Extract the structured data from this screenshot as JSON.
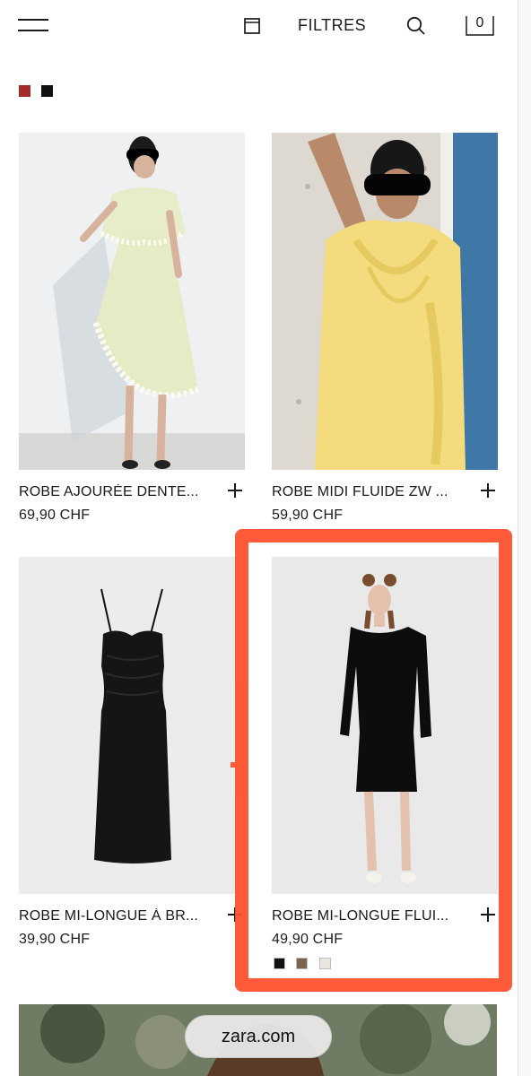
{
  "header": {
    "filters_label": "FILTRES",
    "cart_count": "0",
    "icons": [
      "menu-icon",
      "grid-view-icon",
      "search-icon",
      "cart-icon"
    ]
  },
  "color_filters": [
    "#a52a2a",
    "#111111"
  ],
  "products": [
    {
      "name": "ROBE AJOURÉE DENTE...",
      "price": "69,90 CHF",
      "image": "woman in light green lace dress"
    },
    {
      "name": "ROBE MIDI FLUIDE ZW ...",
      "price": "59,90 CHF",
      "image": "woman in yellow draped dress"
    },
    {
      "name": "ROBE MI-LONGUE À BR...",
      "price": "39,90 CHF",
      "image": "black slip dress"
    },
    {
      "name": "ROBE MI-LONGUE FLUI...",
      "price": "49,90 CHF",
      "image": "woman in black long-sleeve dress",
      "swatches": [
        "#111111",
        "#7b654f",
        "#e9e5df"
      ]
    }
  ],
  "highlight_color": "#ff4e2a",
  "url_bar": {
    "text": "zara.com"
  }
}
